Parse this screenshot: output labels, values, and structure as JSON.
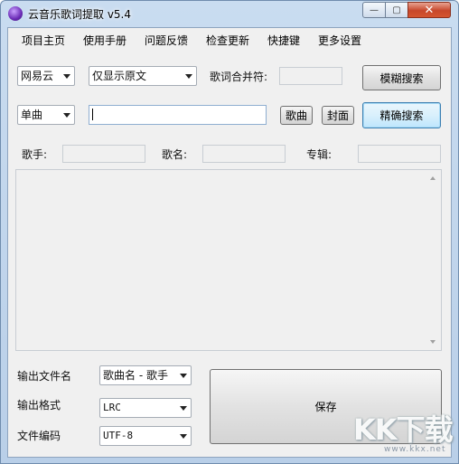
{
  "window": {
    "title": "云音乐歌词提取 v5.4",
    "minimize_glyph": "—",
    "maximize_glyph": "▢",
    "close_glyph": "✕"
  },
  "menu": [
    "项目主页",
    "使用手册",
    "问题反馈",
    "检查更新",
    "快捷键",
    "更多设置"
  ],
  "search": {
    "source_value": "网易云",
    "display_mode_value": "仅显示原文",
    "merge_label": "歌词合并符:",
    "merge_value": "",
    "fuzzy_search_label": "模糊搜索",
    "search_type_value": "单曲",
    "query_value": "",
    "song_button_label": "歌曲",
    "cover_button_label": "封面",
    "exact_search_label": "精确搜索"
  },
  "info": {
    "singer_label": "歌手:",
    "singer_value": "",
    "song_name_label": "歌名:",
    "song_name_value": "",
    "album_label": "专辑:",
    "album_value": ""
  },
  "lyrics": {
    "content": ""
  },
  "output": {
    "filename_label": "输出文件名",
    "filename_value": "歌曲名 - 歌手",
    "format_label": "输出格式",
    "format_value": "LRC",
    "encoding_label": "文件编码",
    "encoding_value": "UTF-8",
    "save_label": "保存"
  },
  "watermark": {
    "brand": "KK下载",
    "site": "www.kkx.net"
  }
}
